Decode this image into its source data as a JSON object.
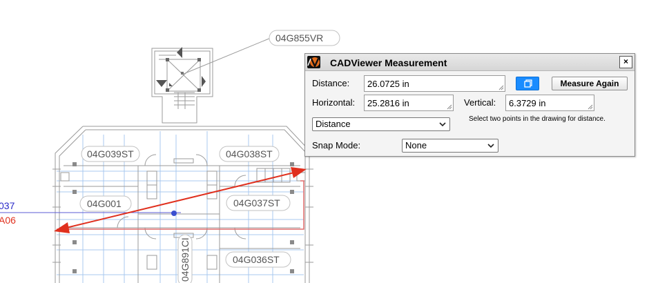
{
  "drawing": {
    "room_labels": [
      "04G855VR",
      "04G039ST",
      "04G038ST",
      "04G001",
      "04G037ST",
      "04G036ST",
      "04G891CI"
    ],
    "side_labels": [
      "037",
      "A06"
    ],
    "colors": {
      "measure_line": "#e0301e",
      "side_label_top": "#2828c8",
      "side_label_bottom": "#e0301e",
      "grid_lines": "#a9c8ef"
    }
  },
  "dialog": {
    "title": "CADViewer Measurement",
    "close_label": "×",
    "logo_icon": "cadviewer-logo-icon",
    "distance_label": "Distance:",
    "distance_value": "26.0725 in",
    "horizontal_label": "Horizontal:",
    "horizontal_value": "25.2816 in",
    "vertical_label": "Vertical:",
    "vertical_value": "6.3729 in",
    "copy_icon": "copy-icon",
    "measure_again_label": "Measure Again",
    "mode_selected": "Distance",
    "hint": "Select two points in the drawing for distance.",
    "snap_mode_label": "Snap Mode:",
    "snap_mode_selected": "None",
    "accent_color": "#1a8cff"
  }
}
